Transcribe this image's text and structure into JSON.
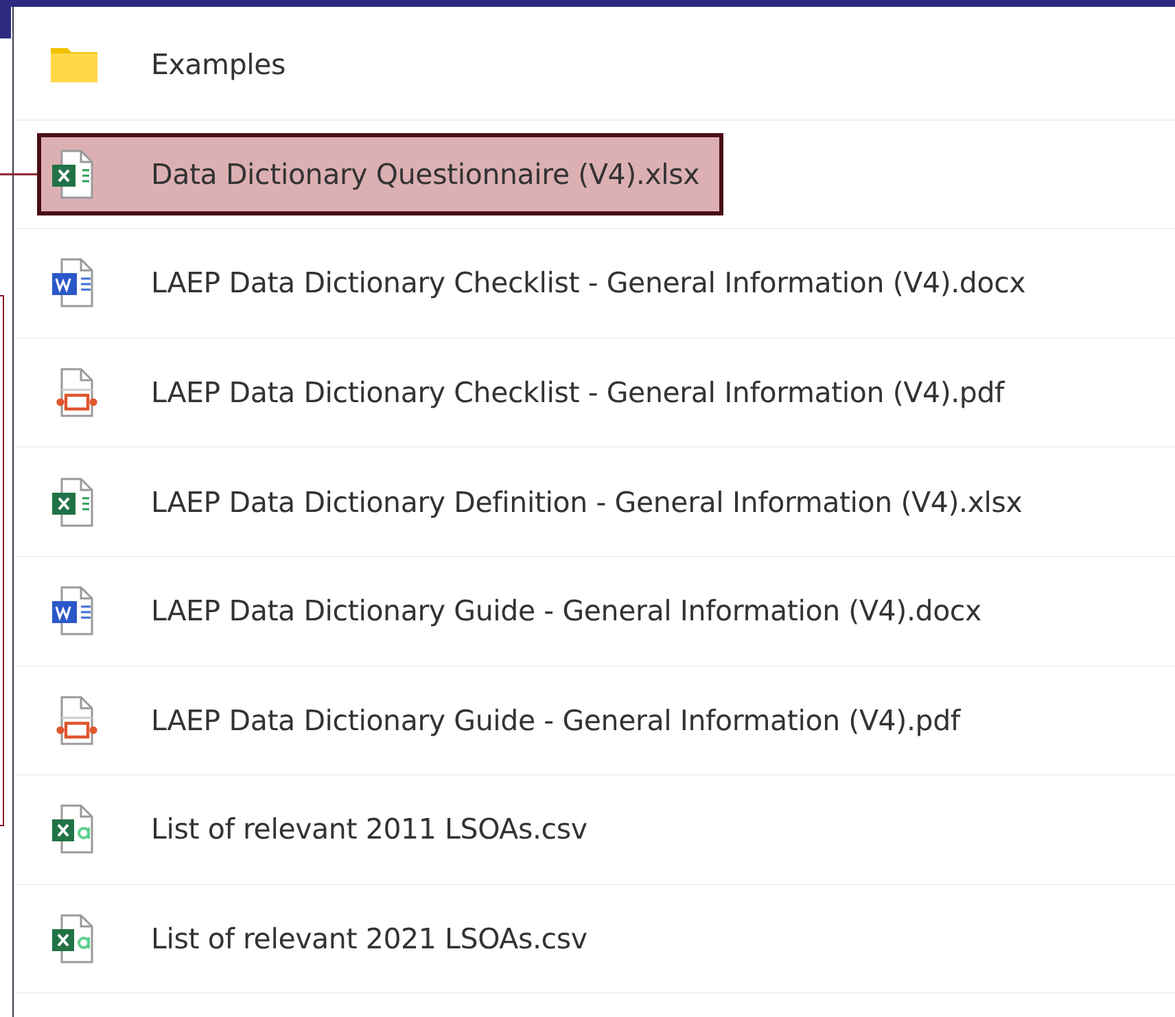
{
  "files": [
    {
      "kind": "folder",
      "name": "Examples",
      "selected": false
    },
    {
      "kind": "excel",
      "name": "Data Dictionary Questionnaire (V4).xlsx",
      "selected": true
    },
    {
      "kind": "word",
      "name": "LAEP Data Dictionary Checklist - General Information (V4).docx",
      "selected": false
    },
    {
      "kind": "pdf",
      "name": "LAEP Data Dictionary Checklist - General Information (V4).pdf",
      "selected": false
    },
    {
      "kind": "excel",
      "name": "LAEP Data Dictionary Definition - General Information (V4).xlsx",
      "selected": false
    },
    {
      "kind": "word",
      "name": "LAEP Data Dictionary Guide - General Information (V4).docx",
      "selected": false
    },
    {
      "kind": "pdf",
      "name": "LAEP Data Dictionary Guide - General Information (V4).pdf",
      "selected": false
    },
    {
      "kind": "csv",
      "name": "List of relevant 2011 LSOAs.csv",
      "selected": false
    },
    {
      "kind": "csv",
      "name": "List of relevant 2021 LSOAs.csv",
      "selected": false
    }
  ]
}
